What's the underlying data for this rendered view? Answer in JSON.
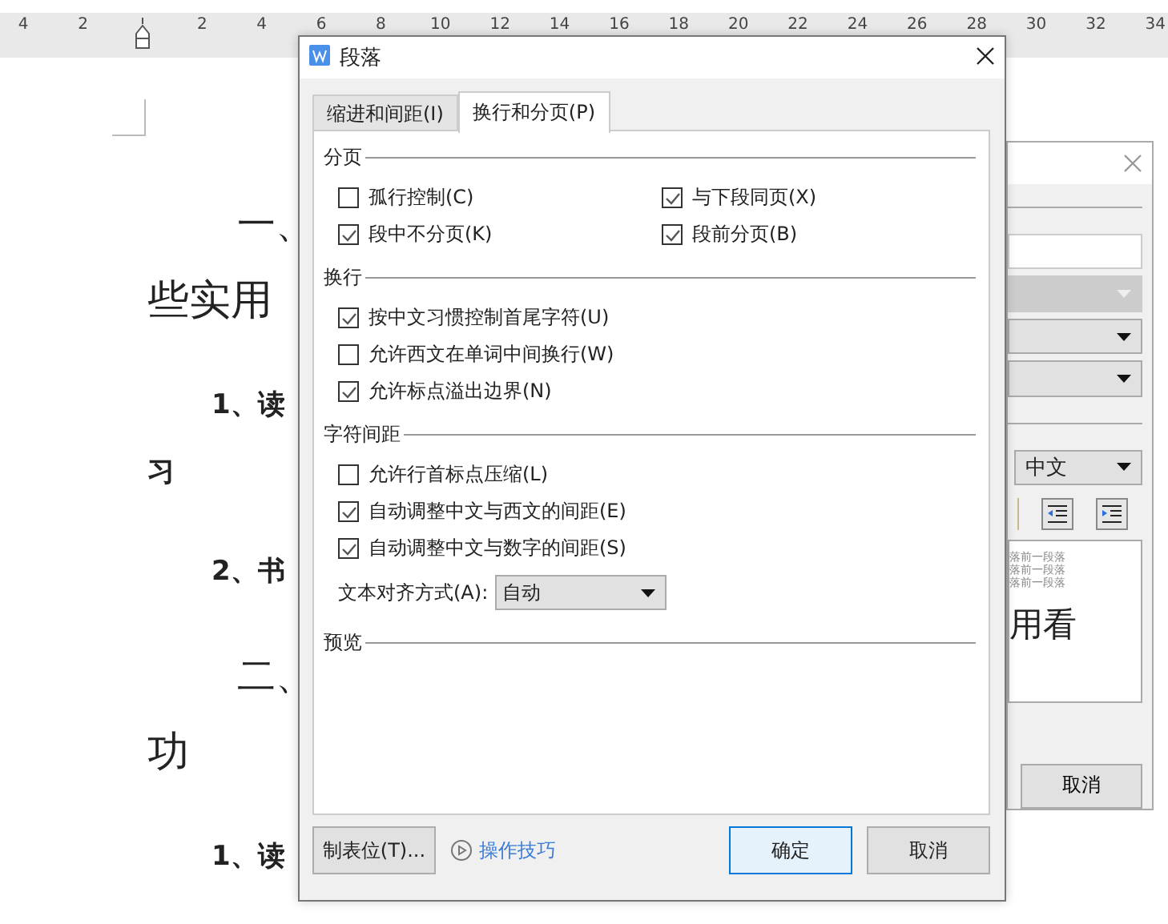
{
  "ruler": {
    "left_labels": [
      "4",
      "2"
    ],
    "right_labels": [
      "2",
      "4",
      "6",
      "8",
      "10",
      "12",
      "14",
      "16",
      "18",
      "20",
      "22",
      "24",
      "26",
      "28",
      "30",
      "32",
      "34"
    ]
  },
  "document": {
    "lines": [
      {
        "kind": "heading",
        "text": "一、"
      },
      {
        "kind": "body",
        "text": "些实用"
      },
      {
        "kind": "item",
        "text": "1、读"
      },
      {
        "kind": "item_cont",
        "text": "习"
      },
      {
        "kind": "item",
        "text": "2、书"
      },
      {
        "kind": "heading",
        "text": "二、"
      },
      {
        "kind": "body",
        "text": "功"
      },
      {
        "kind": "item",
        "text": "1、读"
      }
    ]
  },
  "back_dialog": {
    "dropdowns": [
      {
        "disabled": true
      },
      {
        "disabled": false
      },
      {
        "disabled": false
      }
    ],
    "language": "中文",
    "preview_lines": [
      "落前一段落",
      "落前一段落",
      "落前一段落"
    ],
    "preview_text": "用看",
    "cancel": "取消"
  },
  "dialog": {
    "title": "段落",
    "tabs": [
      {
        "label": "缩进和间距(I)",
        "selected": false
      },
      {
        "label": "换行和分页(P)",
        "selected": true
      }
    ],
    "sections": [
      {
        "title": "分页",
        "kind": "two_column",
        "options": [
          {
            "label": "孤行控制(C)",
            "checked": false
          },
          {
            "label": "与下段同页(X)",
            "checked": true
          },
          {
            "label": "段中不分页(K)",
            "checked": true
          },
          {
            "label": "段前分页(B)",
            "checked": true
          }
        ]
      },
      {
        "title": "换行",
        "kind": "one_column",
        "options": [
          {
            "label": "按中文习惯控制首尾字符(U)",
            "checked": true
          },
          {
            "label": "允许西文在单词中间换行(W)",
            "checked": false
          },
          {
            "label": "允许标点溢出边界(N)",
            "checked": true
          }
        ]
      },
      {
        "title": "字符间距",
        "kind": "one_column",
        "options": [
          {
            "label": "允许行首标点压缩(L)",
            "checked": false
          },
          {
            "label": "自动调整中文与西文的间距(E)",
            "checked": true
          },
          {
            "label": "自动调整中文与数字的间距(S)",
            "checked": true
          }
        ]
      }
    ],
    "alignment": {
      "label": "文本对齐方式(A):",
      "value": "自动"
    },
    "preview_title": "预览",
    "footer": [
      {
        "kind": "button",
        "label": "制表位(T)...",
        "default": false
      },
      {
        "kind": "link",
        "label": "操作技巧"
      },
      {
        "kind": "spacer"
      },
      {
        "kind": "button",
        "label": "确定",
        "default": true
      },
      {
        "kind": "button",
        "label": "取消",
        "default": false
      }
    ]
  }
}
